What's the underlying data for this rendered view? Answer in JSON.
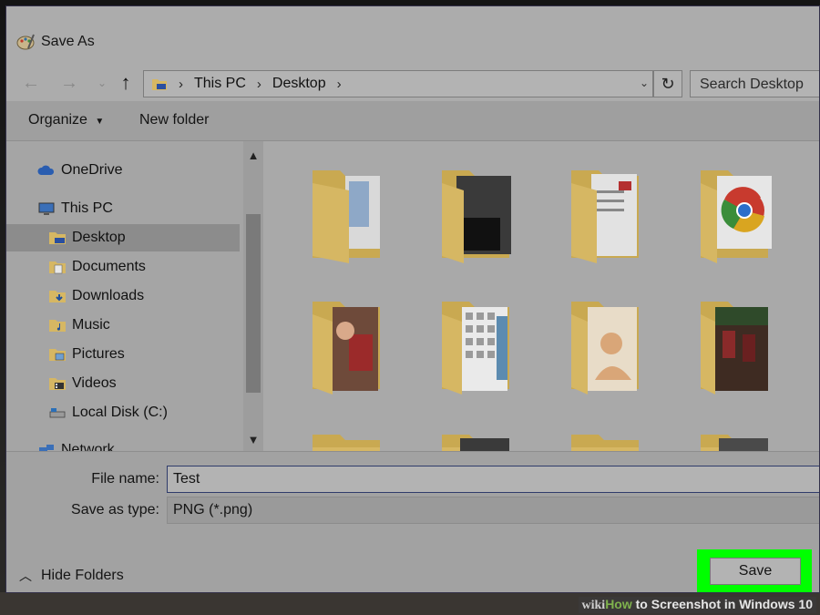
{
  "dialog": {
    "title": "Save As"
  },
  "address": {
    "crumbs": [
      "This PC",
      "Desktop"
    ],
    "search_placeholder": "Search Desktop"
  },
  "toolbar": {
    "organize_label": "Organize",
    "new_folder_label": "New folder"
  },
  "nav": {
    "items": [
      {
        "label": "OneDrive",
        "icon": "cloud-icon"
      },
      {
        "label": "This PC",
        "icon": "computer-icon"
      },
      {
        "label": "Desktop",
        "icon": "desktop-folder-icon",
        "selected": true
      },
      {
        "label": "Documents",
        "icon": "documents-folder-icon"
      },
      {
        "label": "Downloads",
        "icon": "downloads-folder-icon"
      },
      {
        "label": "Music",
        "icon": "music-folder-icon"
      },
      {
        "label": "Pictures",
        "icon": "pictures-folder-icon"
      },
      {
        "label": "Videos",
        "icon": "videos-folder-icon"
      },
      {
        "label": "Local Disk (C:)",
        "icon": "disk-icon"
      },
      {
        "label": "Network",
        "icon": "network-icon"
      }
    ]
  },
  "form": {
    "filename_label": "File name:",
    "filename_value": "Test",
    "type_label": "Save as type:",
    "type_value": "PNG (*.png)"
  },
  "footer": {
    "hide_folders_label": "Hide Folders",
    "save_label": "Save"
  },
  "watermark": {
    "wiki": "wiki",
    "how": "How",
    "rest": " to Screenshot in Windows 10"
  },
  "colors": {
    "highlight": "#00ff00",
    "folder": "#d6b763"
  }
}
